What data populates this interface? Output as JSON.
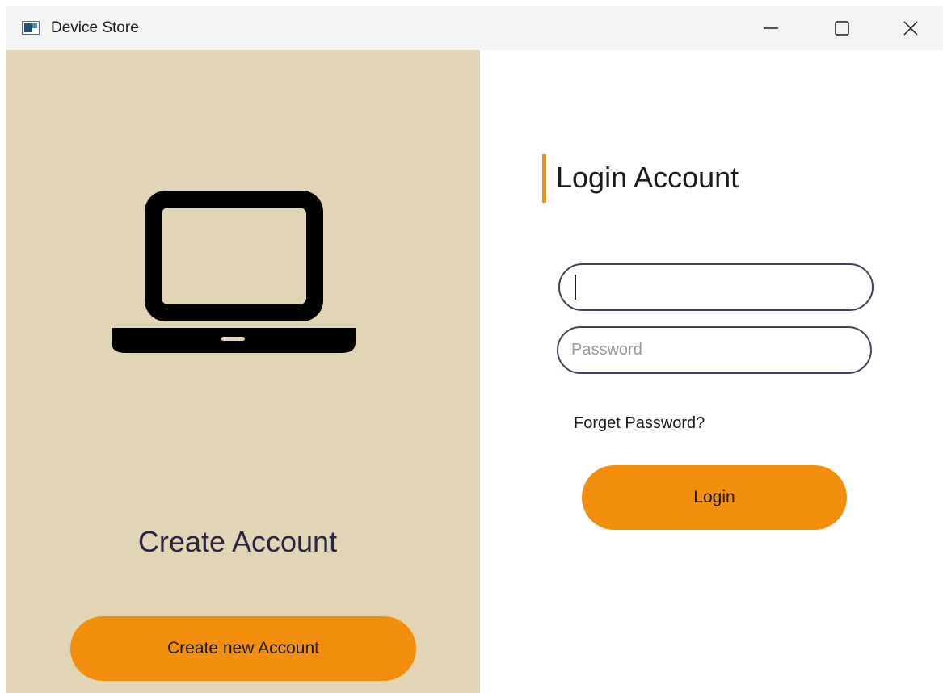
{
  "window": {
    "title": "Device Store",
    "controls": [
      "minimize-icon",
      "maximize-icon",
      "close-icon"
    ]
  },
  "left_panel": {
    "icon": "laptop-icon",
    "heading": "Create Account",
    "button_label": "Create new Account"
  },
  "right_panel": {
    "heading": "Login Account",
    "username": {
      "value": "",
      "placeholder": ""
    },
    "password": {
      "value": "",
      "placeholder": "Password"
    },
    "forget_link": "Forget Password?",
    "login_label": "Login"
  },
  "colors": {
    "accent": "#f28e0c",
    "left_background": "#e2d5b6",
    "field_border": "#4a3f5a",
    "heading_text": "#2a2540"
  }
}
